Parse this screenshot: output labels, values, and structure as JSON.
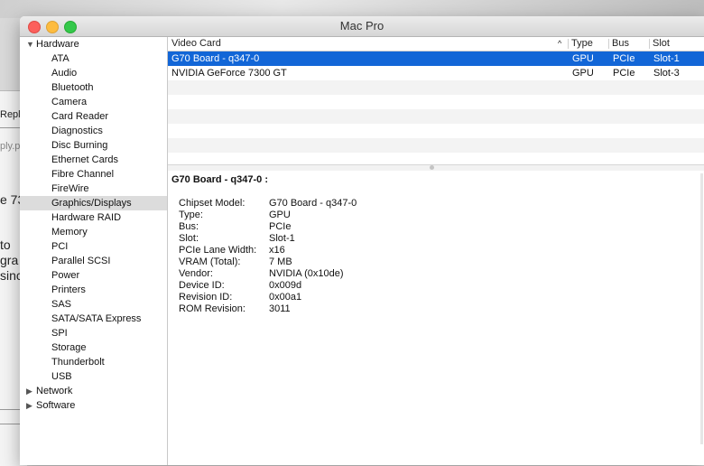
{
  "background": {
    "fragments": [
      "Reply",
      "ply.p",
      "e 73",
      "to",
      "gra",
      "sinc"
    ]
  },
  "window": {
    "title": "Mac Pro"
  },
  "sidebar": {
    "hardware": {
      "label": "Hardware",
      "items": [
        "ATA",
        "Audio",
        "Bluetooth",
        "Camera",
        "Card Reader",
        "Diagnostics",
        "Disc Burning",
        "Ethernet Cards",
        "Fibre Channel",
        "FireWire",
        "Graphics/Displays",
        "Hardware RAID",
        "Memory",
        "PCI",
        "Parallel SCSI",
        "Power",
        "Printers",
        "SAS",
        "SATA/SATA Express",
        "SPI",
        "Storage",
        "Thunderbolt",
        "USB"
      ],
      "selected": "Graphics/Displays"
    },
    "network": {
      "label": "Network"
    },
    "software": {
      "label": "Software"
    }
  },
  "table": {
    "columns": [
      "Video Card",
      "Type",
      "Bus",
      "Slot"
    ],
    "sort_indicator": "^",
    "rows": [
      {
        "name": "G70 Board - q347-0",
        "type": "GPU",
        "bus": "PCIe",
        "slot": "Slot-1"
      },
      {
        "name": "NVIDIA GeForce 7300 GT",
        "type": "GPU",
        "bus": "PCIe",
        "slot": "Slot-3"
      }
    ]
  },
  "detail": {
    "title": "G70 Board - q347-0  :",
    "fields": [
      {
        "k": "Chipset Model:",
        "v": "G70 Board - q347-0"
      },
      {
        "k": "Type:",
        "v": "GPU"
      },
      {
        "k": "Bus:",
        "v": "PCIe"
      },
      {
        "k": "Slot:",
        "v": "Slot-1"
      },
      {
        "k": "PCIe Lane Width:",
        "v": "x16"
      },
      {
        "k": "VRAM (Total):",
        "v": "7 MB"
      },
      {
        "k": "Vendor:",
        "v": "NVIDIA (0x10de)"
      },
      {
        "k": "Device ID:",
        "v": "0x009d"
      },
      {
        "k": "Revision ID:",
        "v": "0x00a1"
      },
      {
        "k": "ROM Revision:",
        "v": "3011"
      }
    ]
  },
  "colors": {
    "selection": "#1266d7",
    "sidebar_selected": "#dcdcdc"
  }
}
